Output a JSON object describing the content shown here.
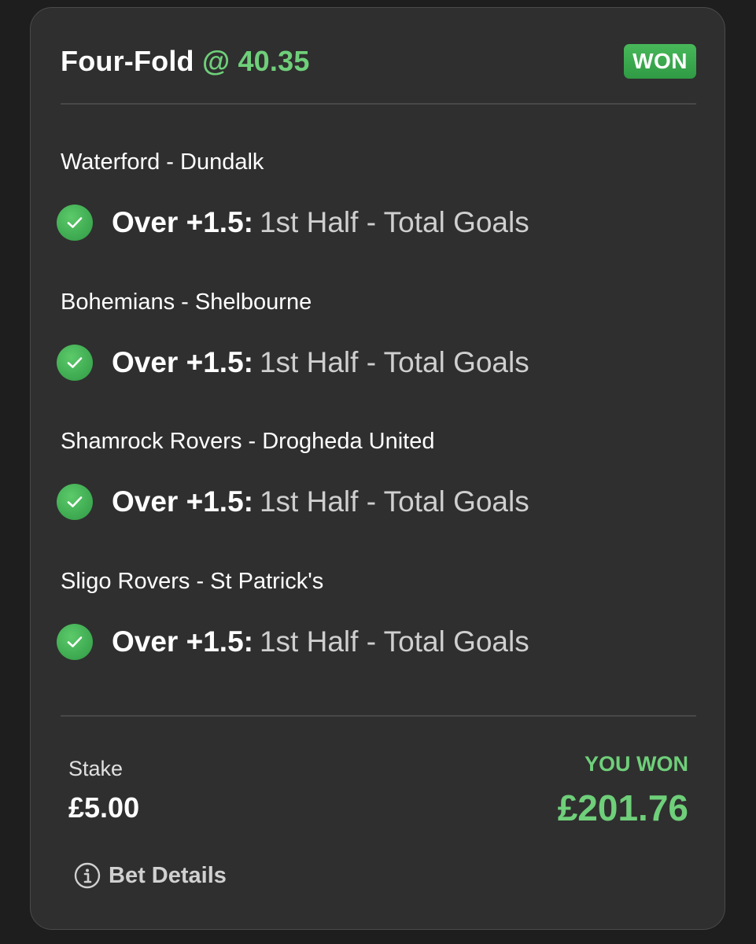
{
  "bet": {
    "title": "Four-Fold",
    "odds": "@ 40.35",
    "status": "WON"
  },
  "legs": [
    {
      "match": "Waterford - Dundalk",
      "selection": "Over +1.5:",
      "market": "1st Half - Total Goals"
    },
    {
      "match": "Bohemians - Shelbourne",
      "selection": "Over +1.5:",
      "market": "1st Half - Total Goals"
    },
    {
      "match": "Shamrock Rovers - Drogheda United",
      "selection": "Over +1.5:",
      "market": "1st Half - Total Goals"
    },
    {
      "match": "Sligo Rovers - St Patrick's",
      "selection": "Over +1.5:",
      "market": "1st Half - Total Goals"
    }
  ],
  "footer": {
    "stake_label": "Stake",
    "stake_value": "£5.00",
    "won_label": "YOU WON",
    "won_value": "£201.76",
    "details_label": "Bet Details"
  },
  "colors": {
    "background": "#1e1e1e",
    "card": "#2f2f2f",
    "accent_green": "#6fcf7a",
    "badge_green": "#3aa84e"
  },
  "icons": {
    "leg_status": "check-circle-icon",
    "details": "info-icon"
  }
}
